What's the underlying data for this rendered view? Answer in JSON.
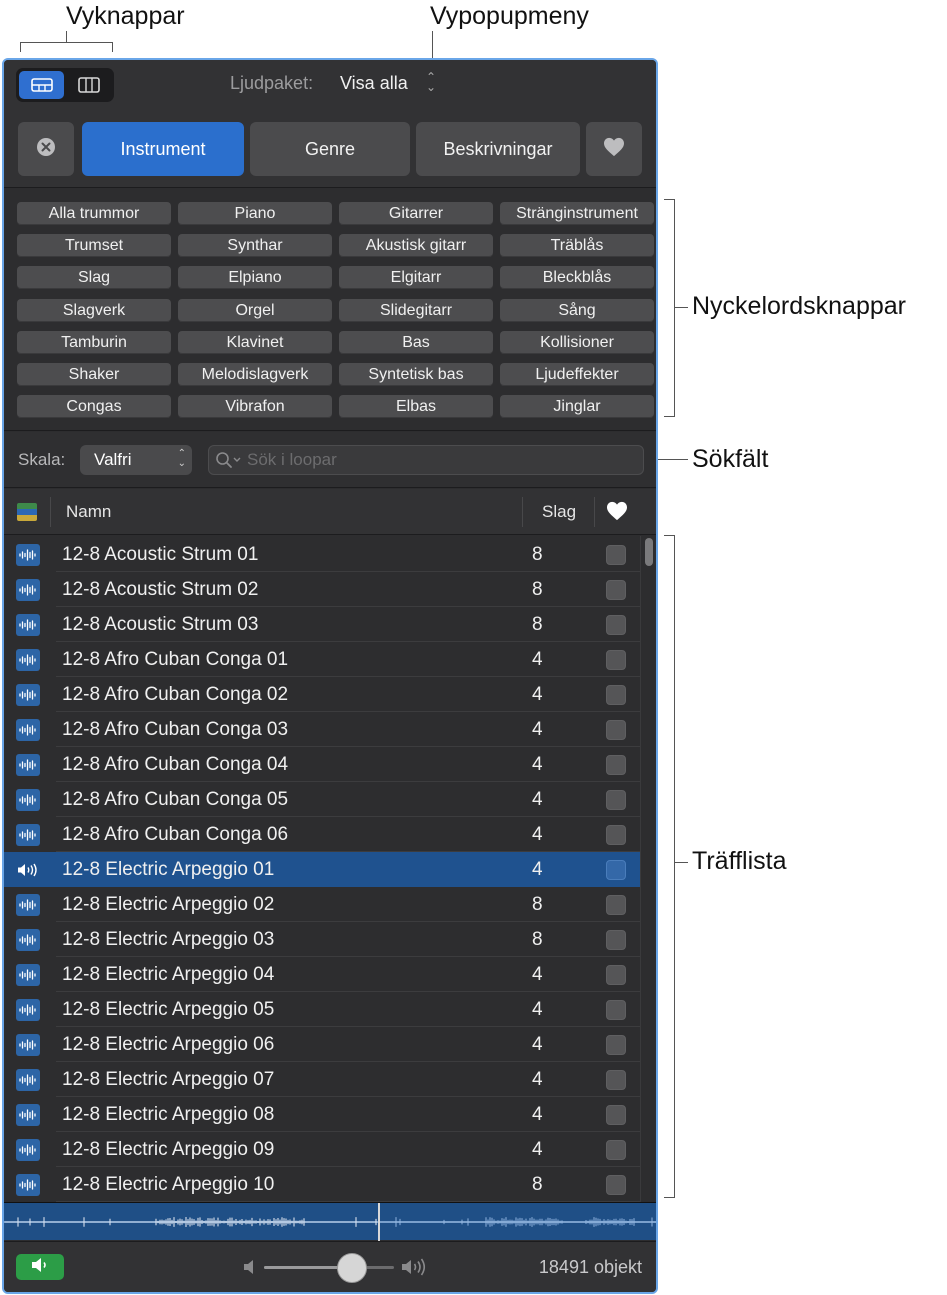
{
  "callouts": {
    "view_buttons": "Vyknappar",
    "view_popup": "Vypopupmeny",
    "keyword_buttons": "Nyckelordsknappar",
    "search_field": "Sökfält",
    "results_list": "Träfflista"
  },
  "top_bar": {
    "sound_pack_label": "Ljudpaket:",
    "sound_pack_value": "Visa alla"
  },
  "tabs": {
    "instrument": "Instrument",
    "genre": "Genre",
    "descriptors": "Beskrivningar"
  },
  "keywords": [
    "Alla trummor",
    "Piano",
    "Gitarrer",
    "Stränginstrument",
    "Trumset",
    "Synthar",
    "Akustisk gitarr",
    "Träblås",
    "Slag",
    "Elpiano",
    "Elgitarr",
    "Bleckblås",
    "Slagverk",
    "Orgel",
    "Slidegitarr",
    "Sång",
    "Tamburin",
    "Klavinet",
    "Bas",
    "Kollisioner",
    "Shaker",
    "Melodislagverk",
    "Syntetisk bas",
    "Ljudeffekter",
    "Congas",
    "Vibrafon",
    "Elbas",
    "Jinglar"
  ],
  "search": {
    "scale_label": "Skala:",
    "scale_value": "Valfri",
    "placeholder": "Sök i loopar"
  },
  "list": {
    "col_name": "Namn",
    "col_beats": "Slag",
    "rows": [
      {
        "name": "12-8 Acoustic Strum 01",
        "beats": "8"
      },
      {
        "name": "12-8 Acoustic Strum 02",
        "beats": "8"
      },
      {
        "name": "12-8 Acoustic Strum 03",
        "beats": "8"
      },
      {
        "name": "12-8 Afro Cuban Conga 01",
        "beats": "4"
      },
      {
        "name": "12-8 Afro Cuban Conga 02",
        "beats": "4"
      },
      {
        "name": "12-8 Afro Cuban Conga 03",
        "beats": "4"
      },
      {
        "name": "12-8 Afro Cuban Conga 04",
        "beats": "4"
      },
      {
        "name": "12-8 Afro Cuban Conga 05",
        "beats": "4"
      },
      {
        "name": "12-8 Afro Cuban Conga 06",
        "beats": "4"
      },
      {
        "name": "12-8 Electric Arpeggio 01",
        "beats": "4",
        "selected": true
      },
      {
        "name": "12-8 Electric Arpeggio 02",
        "beats": "8"
      },
      {
        "name": "12-8 Electric Arpeggio 03",
        "beats": "8"
      },
      {
        "name": "12-8 Electric Arpeggio 04",
        "beats": "4"
      },
      {
        "name": "12-8 Electric Arpeggio 05",
        "beats": "4"
      },
      {
        "name": "12-8 Electric Arpeggio 06",
        "beats": "4"
      },
      {
        "name": "12-8 Electric Arpeggio 07",
        "beats": "4"
      },
      {
        "name": "12-8 Electric Arpeggio 08",
        "beats": "4"
      },
      {
        "name": "12-8 Electric Arpeggio 09",
        "beats": "4"
      },
      {
        "name": "12-8 Electric Arpeggio 10",
        "beats": "8"
      }
    ]
  },
  "footer": {
    "volume_level": 0.68,
    "item_count": "18491 objekt"
  },
  "colors": {
    "accent": "#2b6fcd",
    "selected_row": "#1f528f",
    "speaker_green": "#2c9d47",
    "panel_bg": "#2d2d2f",
    "focus_border": "#6aa6e8"
  },
  "icons": {
    "view_column": "column-view-icon",
    "view_browser": "browser-view-icon",
    "reset": "reset-circle-x-icon",
    "favorites": "heart-icon",
    "search": "magnifier-icon",
    "loop": "audio-loop-waveform-icon",
    "playing": "speaker-playing-icon",
    "preview_speaker": "speaker-icon"
  }
}
